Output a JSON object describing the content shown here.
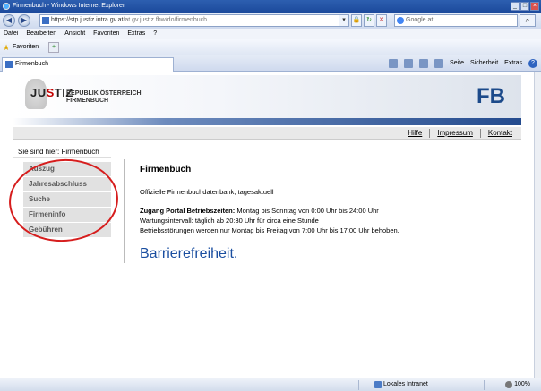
{
  "browser": {
    "window_title": "Firmenbuch - Windows Internet Explorer",
    "address_url": "https://stp.justiz.intra.gv.at",
    "address_url_rest": "/at.gv.justiz.fbw/do/firmenbuch",
    "search_placeholder": "Google.at",
    "menu": [
      "Datei",
      "Bearbeiten",
      "Ansicht",
      "Favoriten",
      "Extras",
      "?"
    ],
    "favorites_label": "Favoriten",
    "tab_title": "Firmenbuch",
    "commands": {
      "page": "Seite",
      "security": "Sicherheit",
      "tools": "Extras"
    },
    "status": {
      "zone": "Lokales Intranet",
      "zoom": "100%"
    }
  },
  "site": {
    "logo_text_a": "JU",
    "logo_text_b": "S",
    "logo_text_c": "TIZ",
    "republic_line1": "REPUBLIK ÖSTERREICH",
    "republic_line2": "FIRMENBUCH",
    "fb_label": "FB",
    "top_links": [
      "Hilfe",
      "Impressum",
      "Kontakt"
    ],
    "breadcrumb": "Sie sind hier: Firmenbuch",
    "side_menu": [
      "Auszug",
      "Jahresabschluss",
      "Suche",
      "Firmeninfo",
      "Gebühren"
    ],
    "main": {
      "title": "Firmenbuch",
      "intro": "Offizielle Firmenbuchdatenbank, tagesaktuell",
      "access_label": "Zugang Portal Betriebszeiten:",
      "access_text": " Montag bis Sonntag von 0:00 Uhr bis 24:00 Uhr",
      "maintenance": "Wartungsintervall: täglich ab 20:30 Uhr für circa eine Stunde",
      "outages": "Betriebsstörungen werden nur Montag bis Freitag von 7:00 Uhr bis 17:00 Uhr behoben.",
      "accessibility_link": "Barrierefreiheit."
    }
  },
  "colors": {
    "accent_blue": "#1c4a8a",
    "annotation_red": "#d61d1d"
  }
}
